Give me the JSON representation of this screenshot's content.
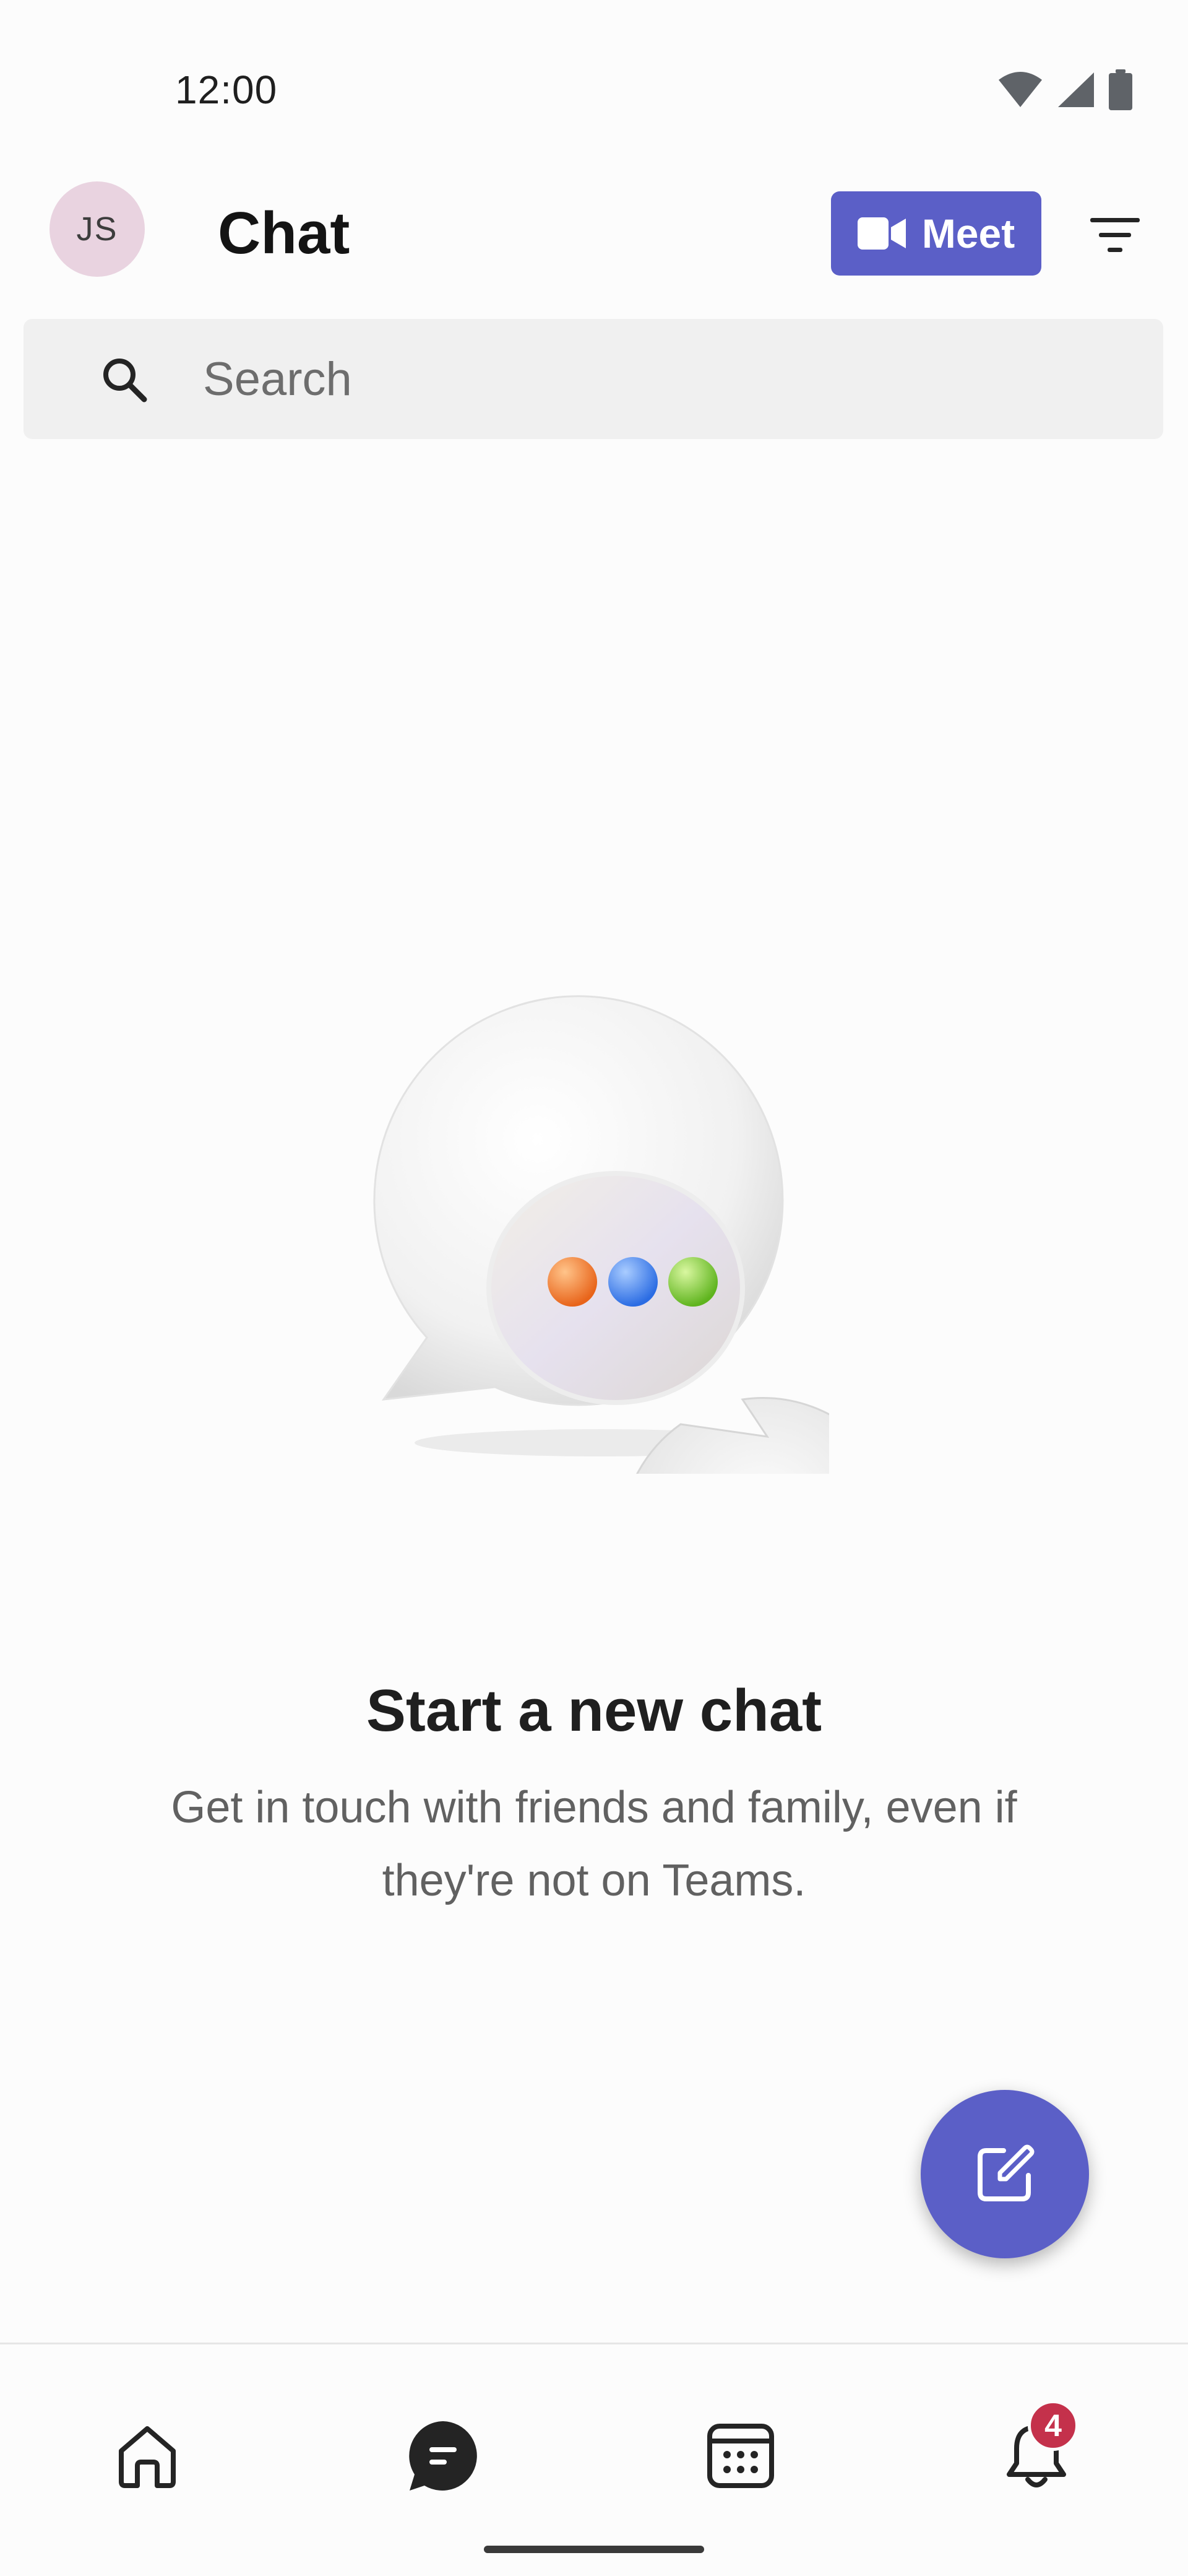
{
  "status_bar": {
    "time": "12:00",
    "icons": [
      "wifi-icon",
      "signal-icon",
      "battery-icon"
    ]
  },
  "header": {
    "avatar_initials": "JS",
    "title": "Chat",
    "meet_label": "Meet",
    "filter_icon": "filter-icon"
  },
  "search": {
    "placeholder": "Search",
    "value": ""
  },
  "empty_state": {
    "title": "Start a new chat",
    "description": "Get in touch with friends and family, even if they're not on Teams."
  },
  "fab": {
    "icon": "compose-icon"
  },
  "bottom_nav": {
    "items": [
      {
        "icon": "home-icon",
        "active": false
      },
      {
        "icon": "chat-icon",
        "active": true
      },
      {
        "icon": "calendar-icon",
        "active": false
      },
      {
        "icon": "bell-icon",
        "active": false,
        "badge": "4"
      }
    ]
  },
  "colors": {
    "accent": "#5b5fc7",
    "badge": "#c4314b",
    "avatar_bg": "#e9d3e0",
    "search_bg": "#f0f0f0"
  }
}
